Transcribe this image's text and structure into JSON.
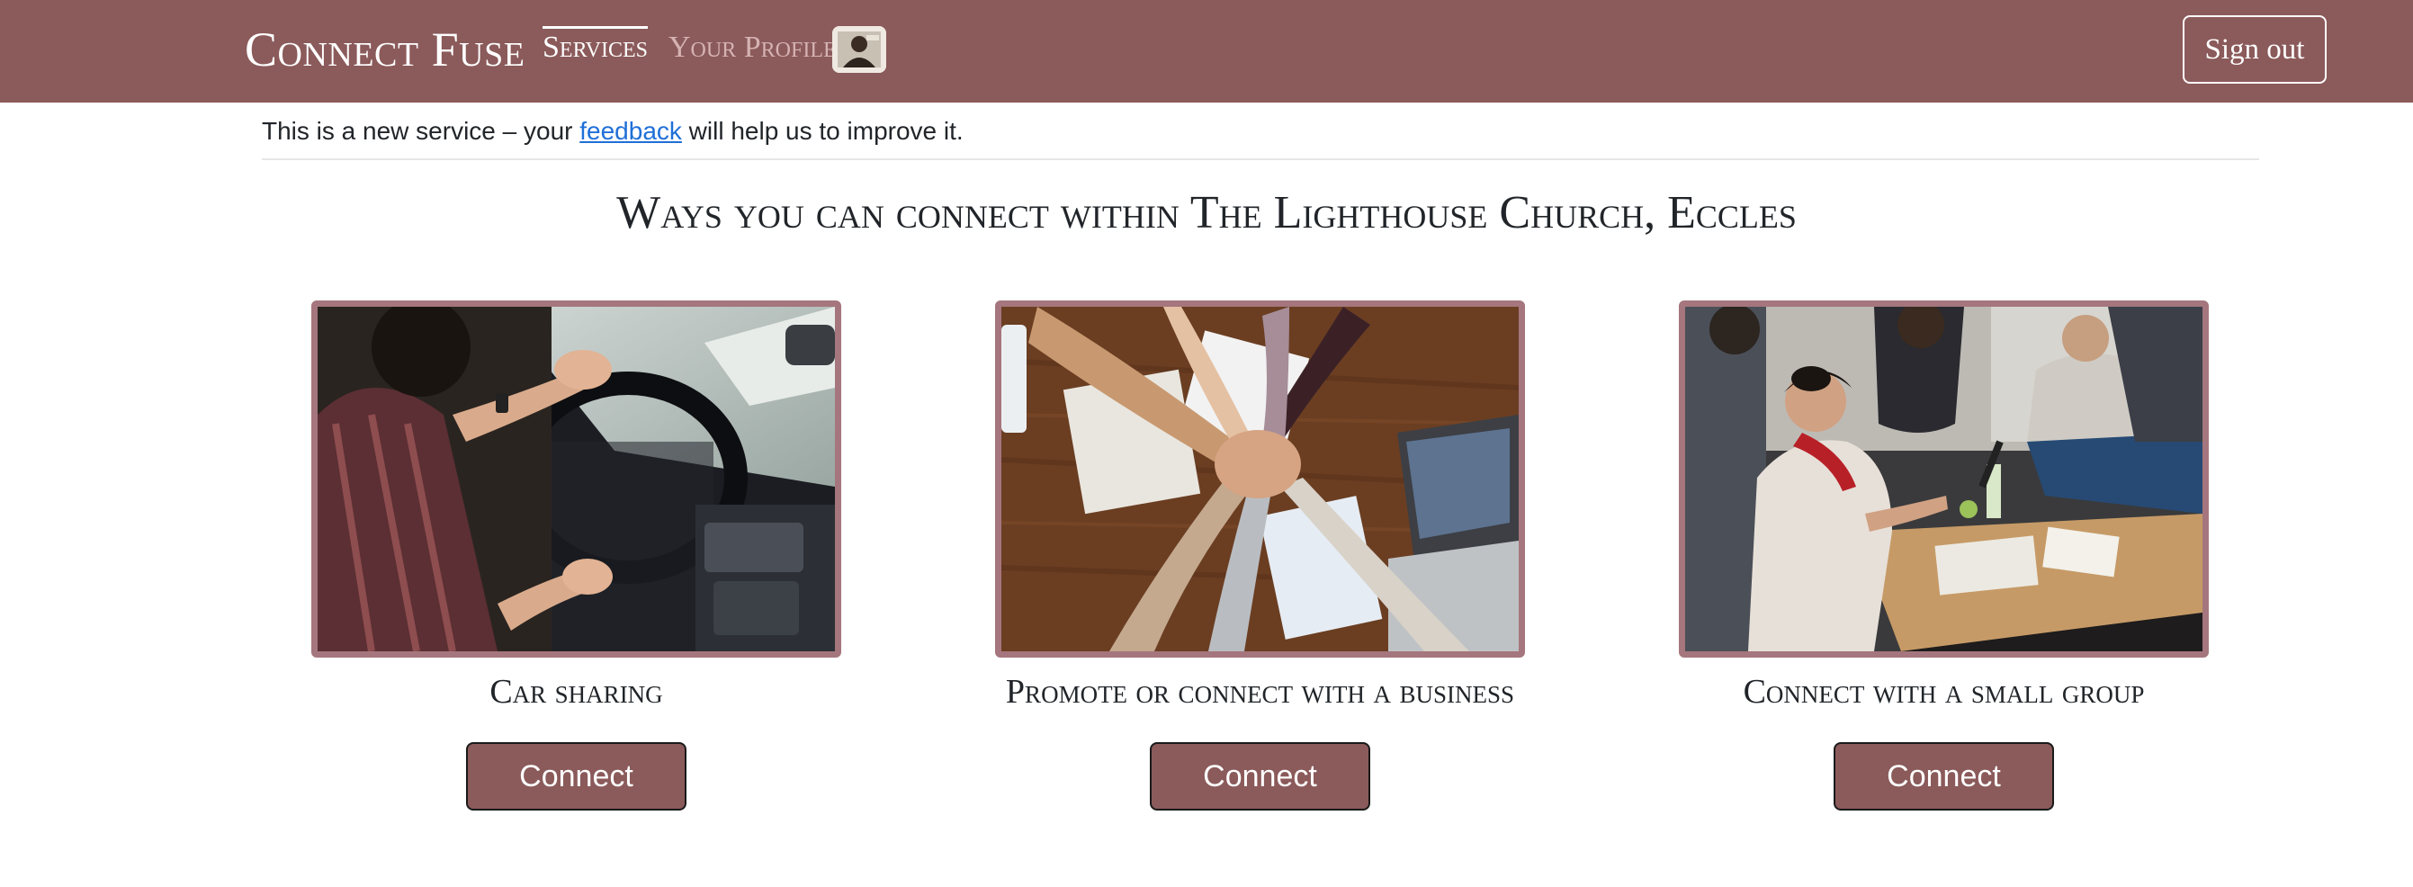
{
  "navbar": {
    "brand": "Connect Fuse",
    "links": [
      {
        "label": "Services",
        "active": true
      },
      {
        "label": "Your Profile",
        "active": false
      }
    ],
    "signout_label": "Sign out",
    "background": "#8b5a5a"
  },
  "banner": {
    "prefix": "This is a new service – your ",
    "link_text": "feedback",
    "suffix": " will help us to improve it."
  },
  "page": {
    "title": "Ways you can connect within The Lighthouse Church, Eccles"
  },
  "services": [
    {
      "label": "Car sharing",
      "button_label": "Connect",
      "image": "person-driving-car-photo"
    },
    {
      "label": "Promote or connect with a business",
      "button_label": "Connect",
      "image": "hands-stacked-over-desk-photo"
    },
    {
      "label": "Connect with a small group",
      "button_label": "Connect",
      "image": "group-meeting-around-table-photo"
    }
  ],
  "colors": {
    "accent": "#8b5a5a",
    "image_border": "#a5767d",
    "link": "#1f6fd8"
  }
}
